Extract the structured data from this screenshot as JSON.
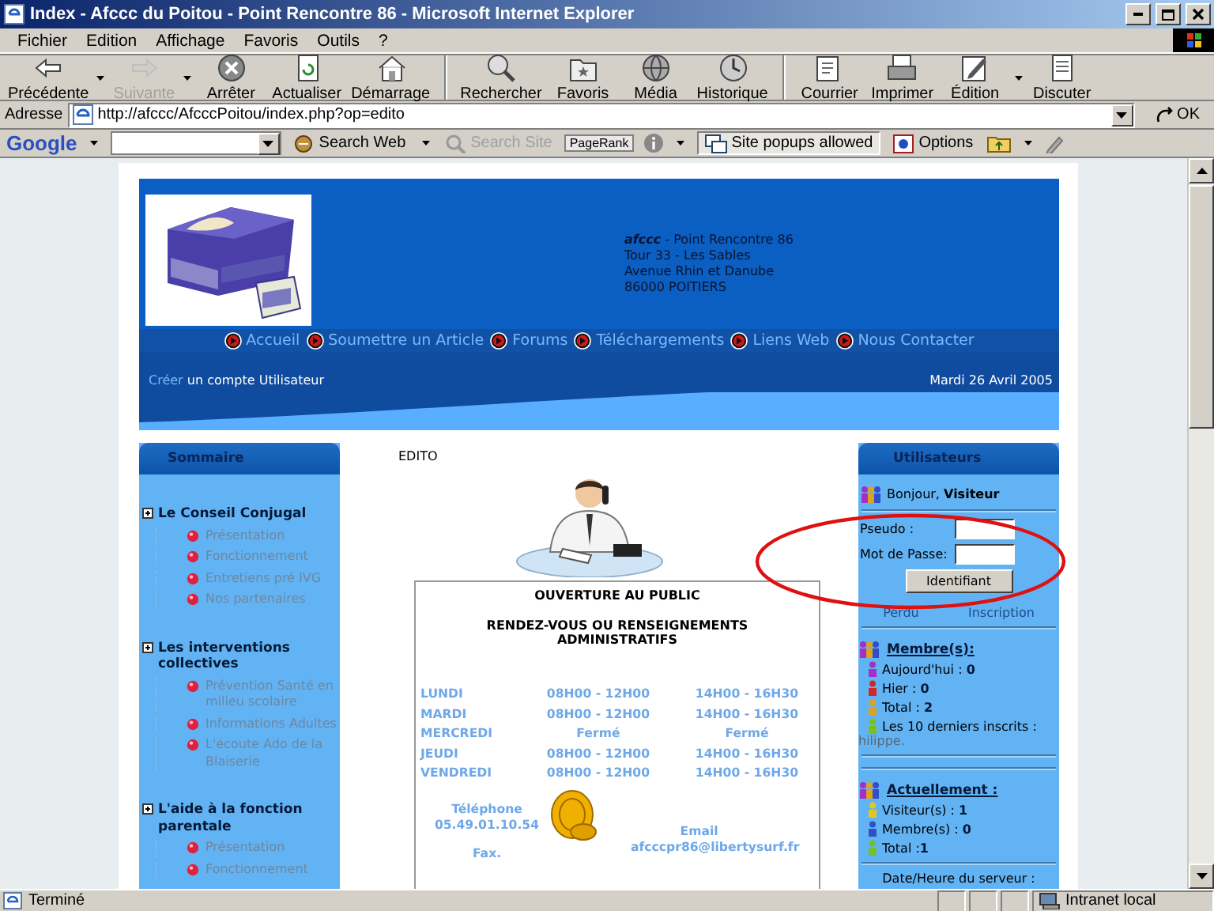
{
  "window": {
    "title": "Index - Afccc du Poitou - Point Rencontre 86 - Microsoft Internet Explorer"
  },
  "menu": [
    "Fichier",
    "Edition",
    "Affichage",
    "Favoris",
    "Outils",
    "?"
  ],
  "toolbar": [
    {
      "label": "Précédente",
      "disabled": false,
      "dropdown": true,
      "separator_before": false
    },
    {
      "label": "Suivante",
      "disabled": true,
      "dropdown": true,
      "separator_before": false
    },
    {
      "label": "Arrêter",
      "disabled": false,
      "dropdown": false,
      "separator_before": false
    },
    {
      "label": "Actualiser",
      "disabled": false,
      "dropdown": false,
      "separator_before": false
    },
    {
      "label": "Démarrage",
      "disabled": false,
      "dropdown": false,
      "separator_before": false
    },
    {
      "label": "Rechercher",
      "disabled": false,
      "dropdown": false,
      "separator_before": true
    },
    {
      "label": "Favoris",
      "disabled": false,
      "dropdown": false,
      "separator_before": false
    },
    {
      "label": "Média",
      "disabled": false,
      "dropdown": false,
      "separator_before": false
    },
    {
      "label": "Historique",
      "disabled": false,
      "dropdown": false,
      "separator_before": false
    },
    {
      "label": "Courrier",
      "disabled": false,
      "dropdown": false,
      "separator_before": true
    },
    {
      "label": "Imprimer",
      "disabled": false,
      "dropdown": false,
      "separator_before": false
    },
    {
      "label": "Édition",
      "disabled": false,
      "dropdown": true,
      "separator_before": false
    },
    {
      "label": "Discuter",
      "disabled": false,
      "dropdown": false,
      "separator_before": false
    }
  ],
  "address_bar": {
    "label": "Adresse",
    "value": "http://afccc/AfcccPoitou/index.php?op=edito",
    "go": "OK"
  },
  "google_bar": {
    "logo": "Google",
    "search_web": "Search Web",
    "search_site": {
      "label": "Search Site",
      "disabled": true
    },
    "pagerank": "PageRank",
    "popups": "Site popups allowed",
    "options": "Options"
  },
  "page": {
    "header": {
      "address_lines": [
        "**afccc** - Point Rencontre 86",
        "Tour 33 - Les Sables",
        "Avenue Rhin et Danube",
        "86000 POITIERS"
      ],
      "nav": [
        "Accueil",
        "Soumettre un Article",
        "Forums",
        "Téléchargements",
        "Liens Web",
        "Nous Contacter"
      ],
      "account": {
        "link": "Créer",
        "text": "un compte Utilisateur"
      },
      "date": "Mardi 26 Avril 2005"
    },
    "summary": {
      "title": "Sommaire",
      "sections": [
        {
          "label": "Le Conseil Conjugal",
          "children": [
            {
              "label": "Présentation"
            },
            {
              "label": "Fonctionnement"
            },
            {
              "label": "Entretiens pré IVG"
            },
            {
              "label": "Nos partenaires"
            }
          ]
        },
        {
          "label": "Les interventions collectives",
          "children": [
            {
              "label": "Prévention Santé en milieu scolaire"
            },
            {
              "label": "Informations Adultes"
            },
            {
              "label": "L'écoute Ado de la Blaiserie"
            }
          ]
        },
        {
          "label": "L'aide à la fonction parentale",
          "children": [
            {
              "label": "Présentation"
            },
            {
              "label": "Fonctionnement"
            }
          ]
        }
      ]
    },
    "edito": {
      "label": "EDITO",
      "notice": {
        "title": "OUVERTURE AU PUBLIC",
        "subtitle": "RENDEZ-VOUS OU RENSEIGNEMENTS ADMINISTRATIFS",
        "schedule": [
          {
            "day": "LUNDI",
            "morning": "08H00 - 12H00",
            "afternoon": "14H00 - 16H30"
          },
          {
            "day": "MARDI",
            "morning": "08H00 - 12H00",
            "afternoon": "14H00 - 16H30"
          },
          {
            "day": "MERCREDI",
            "morning": "Fermé",
            "afternoon": "Fermé"
          },
          {
            "day": "JEUDI",
            "morning": "08H00 - 12H00",
            "afternoon": "14H00 - 16H30"
          },
          {
            "day": "VENDREDI",
            "morning": "08H00 - 12H00",
            "afternoon": "14H00 - 16H30"
          }
        ],
        "phone_label": "Téléphone",
        "phone": "05.49.01.10.54",
        "fax_label": "Fax.",
        "email_label": "Email",
        "email": "afcccpr86@libertysurf.fr"
      }
    },
    "users": {
      "title": "Utilisateurs",
      "greeting": "Bonjour, **Visiteur**",
      "fields": [
        {
          "label": "Pseudo :"
        },
        {
          "label": "Mot de Passe:"
        }
      ],
      "login_button": "Identifiant",
      "links": [
        "Perdu",
        "Inscription"
      ],
      "members": {
        "title": "Membre(s):",
        "items": [
          {
            "text": "Aujourd'hui : **0**",
            "color": "#a030c8"
          },
          {
            "text": "Hier : **0**",
            "color": "#d02828"
          },
          {
            "text": "Total : **2**",
            "color": "#e0a020"
          },
          {
            "text": "Les 10 derniers inscrits :",
            "color": "#78c020"
          }
        ],
        "latest": "hilippe."
      },
      "current": {
        "title": "Actuellement :",
        "items": [
          {
            "text": "Visiteur(s) : **1**",
            "color": "#e0c820"
          },
          {
            "text": "Membre(s) : **0**",
            "color": "#3050c8"
          },
          {
            "text": "Total :**1**",
            "color": "#70c030"
          }
        ]
      },
      "server_date": "Date/Heure du serveur :"
    }
  },
  "status_bar": {
    "text": "Terminé",
    "zone": "Intranet local"
  }
}
